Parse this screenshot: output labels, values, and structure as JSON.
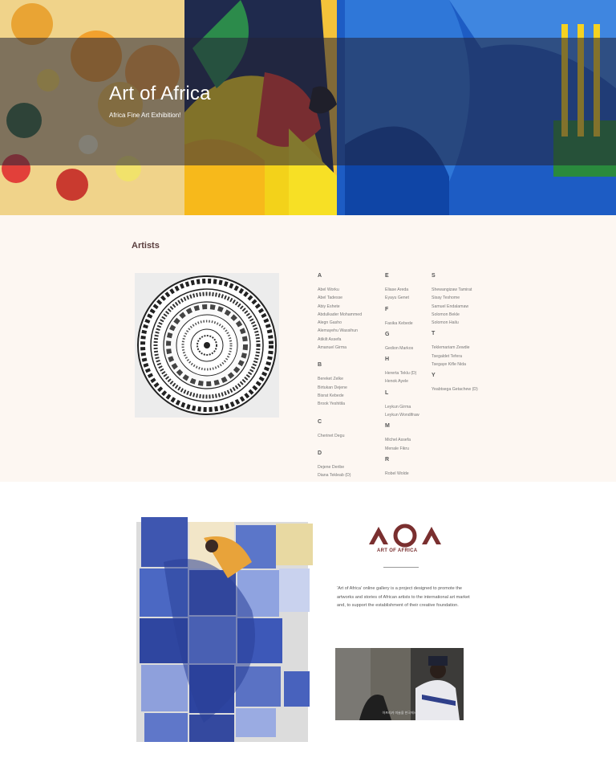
{
  "hero": {
    "title": "Art of Africa",
    "subtitle": "Africa Fine Art Exhibition!"
  },
  "artists": {
    "heading": "Artists",
    "columns": [
      [
        {
          "letter": "A",
          "names": [
            "Abel Worku",
            "Abel Tadesse",
            "Abiy Eshete",
            "Abdulkader Mohammed",
            "Alegn Gasho",
            "Alemayehu Wassihun",
            "Atikilt Assefa",
            "Amanuel Girma"
          ]
        },
        {
          "letter": "B",
          "names": [
            "Bereket Zelke",
            "Birtukan Dejene",
            "Bisrat Kebede",
            "Brook Yeshitila"
          ]
        },
        {
          "letter": "C",
          "names": [
            "Cherinet Degu"
          ]
        },
        {
          "letter": "D",
          "names": [
            "Dejene Deribe",
            "Diana Tekleab (D)"
          ]
        }
      ],
      [
        {
          "letter": "E",
          "names": [
            "Eliase Areda",
            "Eyayu Genet"
          ]
        },
        {
          "letter": "F",
          "names": [
            "Fasika Kebede"
          ]
        },
        {
          "letter": "G",
          "names": [
            "Gedion Markos"
          ]
        },
        {
          "letter": "H",
          "names": [
            "Hererta Teklu (D)",
            "Henok Ayele"
          ]
        },
        {
          "letter": "L",
          "names": [
            "Leykun Girma",
            "Leykun Wondifraw"
          ]
        },
        {
          "letter": "M",
          "names": [
            "Michel Assefa",
            "Menale Fikru"
          ]
        },
        {
          "letter": "R",
          "names": [
            "Robel Wolde"
          ]
        }
      ],
      [
        {
          "letter": "S",
          "names": [
            "Shewangizaw Tamirat",
            "Sisay Teshome",
            "Samuel Endalamaw",
            "Solomon Bekle",
            "Solomon Hailu"
          ]
        },
        {
          "letter": "T",
          "names": [
            "Teklemariam Zewdie",
            "Tsegaldet Tefera",
            "Tsegaye Kifle Nida"
          ]
        },
        {
          "letter": "Y",
          "names": [
            "Yeabtsega Getachew (D)"
          ]
        }
      ]
    ]
  },
  "about": {
    "logo_mark": "AOA",
    "logo_text": "ART OF AFRICA",
    "description": "'Art of Africa' online gallery is a project designed to promote the artworks and stories of African artists to the international art market and, to support the establishment of their creative foundation.",
    "video_caption": "아프리카 미술을 한국에서"
  },
  "colors": {
    "artists_bg": "#fdf7f2",
    "brand": "#7a2f2f"
  }
}
